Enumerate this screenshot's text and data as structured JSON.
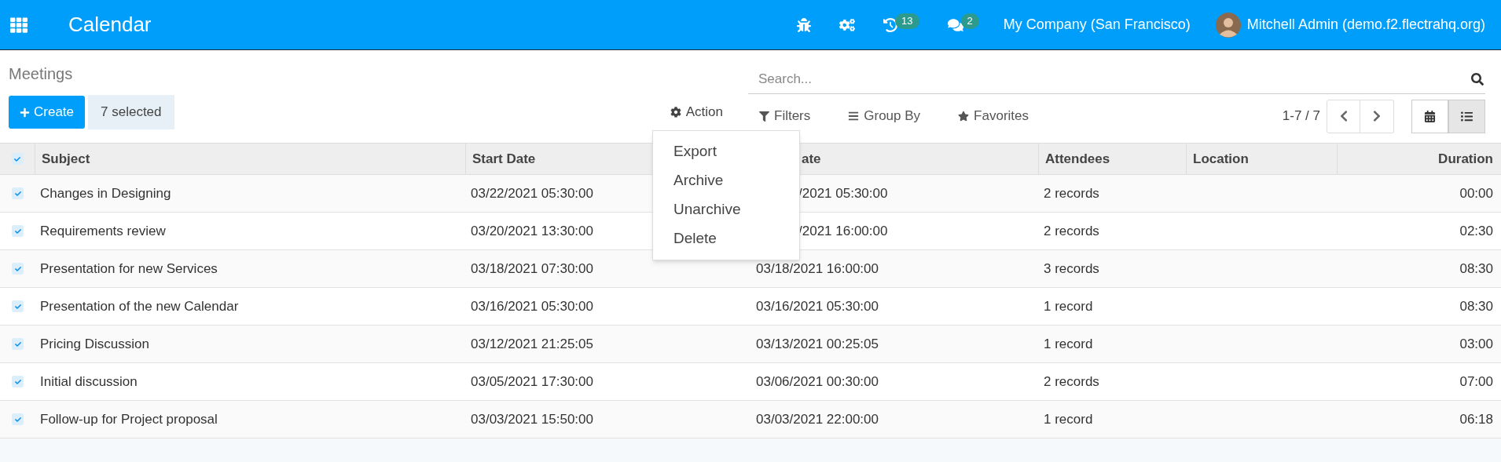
{
  "navbar": {
    "app_title": "Calendar",
    "systray": [
      {
        "kind": "bug"
      },
      {
        "kind": "settings"
      },
      {
        "kind": "activity",
        "badge": "13"
      },
      {
        "kind": "messages",
        "badge": "2"
      }
    ],
    "company": "My Company (San Francisco)",
    "user": "Mitchell Admin (demo.f2.flectrahq.org)"
  },
  "breadcrumb": "Meetings",
  "search": {
    "placeholder": "Search..."
  },
  "buttons": {
    "create": "Create",
    "selected_count": "7 selected"
  },
  "toolbar": [
    {
      "kind": "action",
      "label": "Action",
      "open": true
    },
    {
      "kind": "filter",
      "label": "Filters",
      "open": false
    },
    {
      "kind": "group",
      "label": "Group By",
      "open": false
    },
    {
      "kind": "favorite",
      "label": "Favorites",
      "open": false
    }
  ],
  "action_menu": [
    "Export",
    "Archive",
    "Unarchive",
    "Delete"
  ],
  "pager": "1-7 / 7",
  "views": [
    {
      "kind": "calendar",
      "selected": false
    },
    {
      "kind": "list",
      "selected": true
    }
  ],
  "table": {
    "all_checked": true,
    "columns": [
      "Subject",
      "Start Date",
      "ate",
      "Attendees",
      "Location",
      "Duration"
    ],
    "rows": [
      {
        "selected": true,
        "cells": [
          "Changes in Designing",
          "03/22/2021 05:30:00",
          "/2021 05:30:00",
          "2 records",
          "",
          "00:00"
        ]
      },
      {
        "selected": true,
        "cells": [
          "Requirements review",
          "03/20/2021 13:30:00",
          "/2021 16:00:00",
          "2 records",
          "",
          "02:30"
        ]
      },
      {
        "selected": true,
        "cells": [
          "Presentation for new Services",
          "03/18/2021 07:30:00",
          "03/18/2021 16:00:00",
          "3 records",
          "",
          "08:30"
        ]
      },
      {
        "selected": true,
        "cells": [
          "Presentation of the new Calendar",
          "03/16/2021 05:30:00",
          "03/16/2021 05:30:00",
          "1 record",
          "",
          "08:30"
        ]
      },
      {
        "selected": true,
        "cells": [
          "Pricing Discussion",
          "03/12/2021 21:25:05",
          "03/13/2021 00:25:05",
          "1 record",
          "",
          "03:00"
        ]
      },
      {
        "selected": true,
        "cells": [
          "Initial discussion",
          "03/05/2021 17:30:00",
          "03/06/2021 00:30:00",
          "2 records",
          "",
          "07:00"
        ]
      },
      {
        "selected": true,
        "cells": [
          "Follow-up for Project proposal",
          "03/03/2021 15:50:00",
          "03/03/2021 22:00:00",
          "1 record",
          "",
          "06:18"
        ]
      }
    ]
  }
}
